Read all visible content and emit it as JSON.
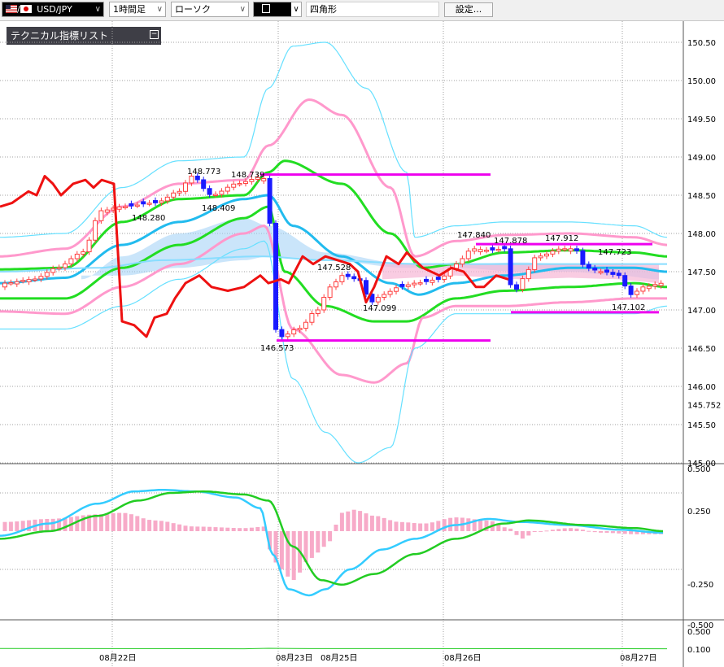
{
  "toolbar": {
    "symbol": "USD/JPY",
    "timeframe": "1時間足",
    "chart_type": "ローソク",
    "draw_tool_icon": "rectangle-icon",
    "shape": "四角形",
    "settings_label": "設定..."
  },
  "indicator_panel": {
    "title": "テクニカル指標リスト"
  },
  "colors": {
    "bull_candle": "#ff4040",
    "bear_candle": "#1a1aff",
    "rsi_red": "#ee1111",
    "bb_sigma3": "#66e0ff",
    "bb_sigma2": "#ff99cc",
    "bb_sigma1": "#22dd22",
    "sma_mid": "#22bbee",
    "hline": "#ee00ee",
    "cloud": "#9ecff5",
    "cloud_bear": "#f7b7d6",
    "macd_line": "#33ccff",
    "signal_line": "#22cc22",
    "hist": "#f7aac8"
  },
  "chart_data": [
    {
      "type": "line",
      "name": "candlestick",
      "x_ticks": [
        "08月22日",
        "08月23日",
        "08月25日",
        "08月26日",
        "08月27日"
      ],
      "y_ticks": [
        "150.50",
        "150.00",
        "149.50",
        "149.00",
        "148.50",
        "148.00",
        "147.50",
        "147.00",
        "146.50",
        "146.00",
        "145.50",
        "145.00"
      ],
      "ylim": [
        145.0,
        150.6
      ],
      "current_price_label": "145.752",
      "price_labels": [
        "148.773",
        "148.739",
        "148.280",
        "148.409",
        "146.573",
        "147.528",
        "147.099",
        "147.840",
        "147.878",
        "147.912",
        "147.723",
        "147.102"
      ],
      "hlines": [
        148.77,
        146.6,
        147.86,
        146.97
      ]
    },
    {
      "type": "line",
      "name": "MACD",
      "y_ticks": [
        "0.500",
        "0.250",
        "-0.250",
        "-0.500"
      ],
      "ylim": [
        -0.5,
        0.5
      ]
    },
    {
      "type": "line",
      "name": "lower-indicator",
      "y_ticks": [
        "0.500",
        "0.100"
      ],
      "ylim": [
        0.1,
        0.5
      ]
    }
  ]
}
